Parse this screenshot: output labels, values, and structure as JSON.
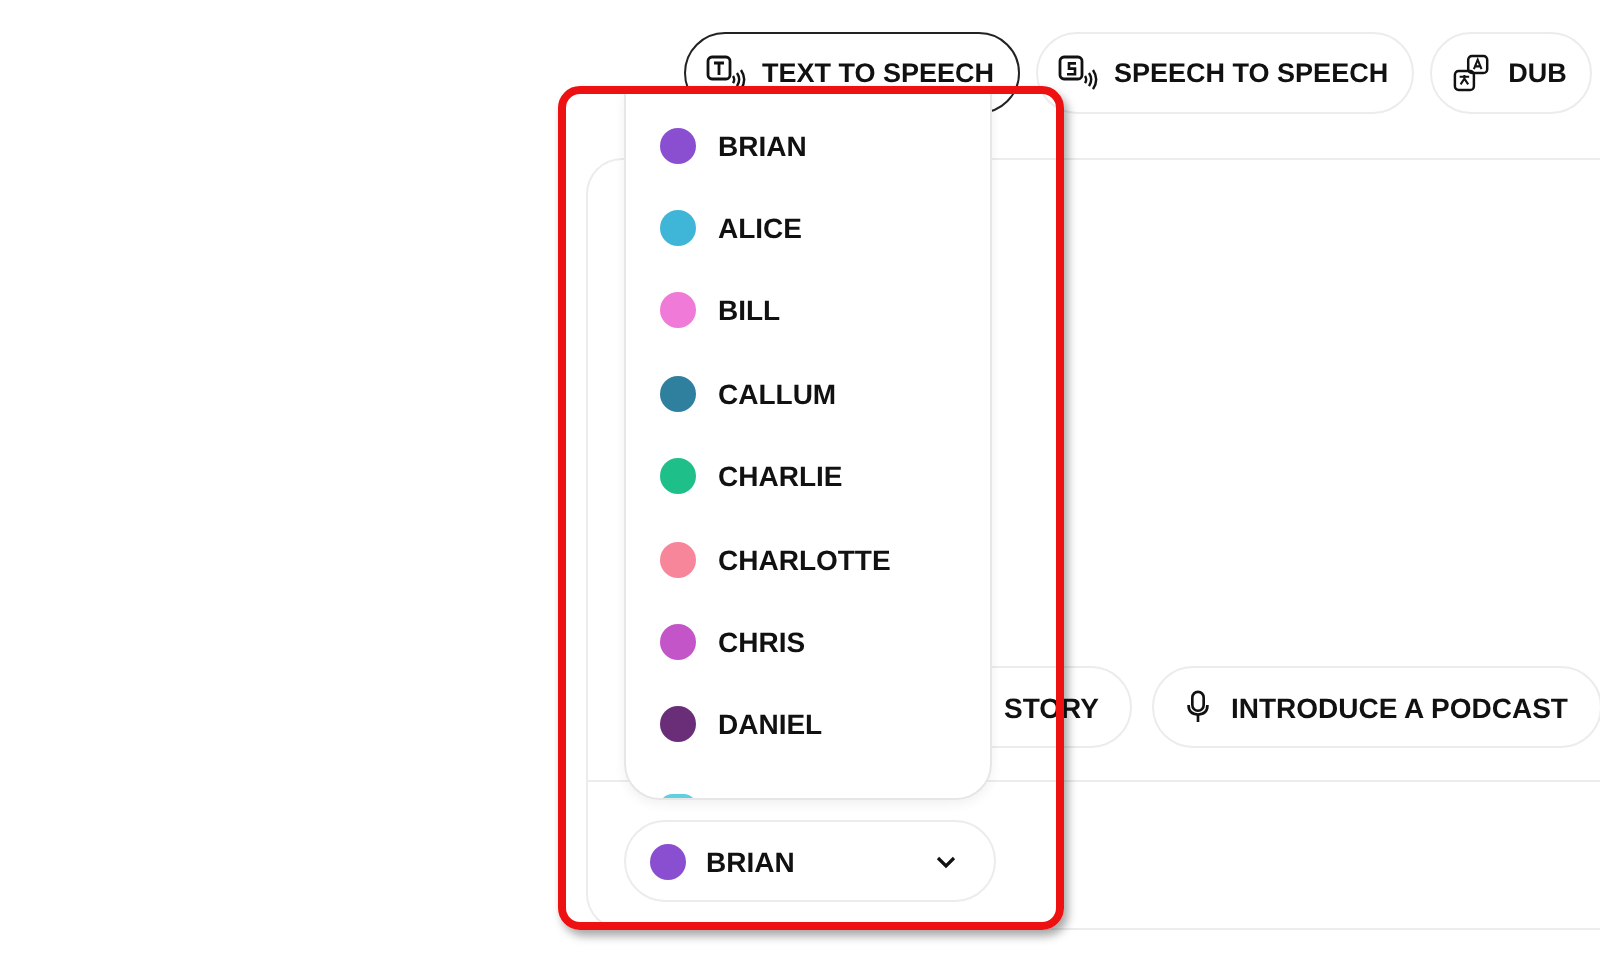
{
  "tabs": [
    {
      "label": "TEXT TO SPEECH",
      "kind": "text",
      "selected": true
    },
    {
      "label": "SPEECH TO SPEECH",
      "kind": "speech",
      "selected": false
    },
    {
      "label": "DUB",
      "kind": "dub",
      "selected": false
    }
  ],
  "prompt_chips": [
    {
      "label": "STORY",
      "kind": "plain"
    },
    {
      "label": "INTRODUCE A PODCAST",
      "kind": "mic"
    }
  ],
  "voice_select": {
    "value": "BRIAN",
    "color": "#8a4fd0"
  },
  "voice_list": [
    {
      "name": "BRIAN",
      "color": "#8a4fd0"
    },
    {
      "name": "ALICE",
      "color": "#3fb6d8"
    },
    {
      "name": "BILL",
      "color": "#f07ad8"
    },
    {
      "name": "CALLUM",
      "color": "#2f7f9e"
    },
    {
      "name": "CHARLIE",
      "color": "#1fbf8a"
    },
    {
      "name": "CHARLOTTE",
      "color": "#f7869a"
    },
    {
      "name": "CHRIS",
      "color": "#c455c8"
    },
    {
      "name": "DANIEL",
      "color": "#6a2d78"
    }
  ]
}
